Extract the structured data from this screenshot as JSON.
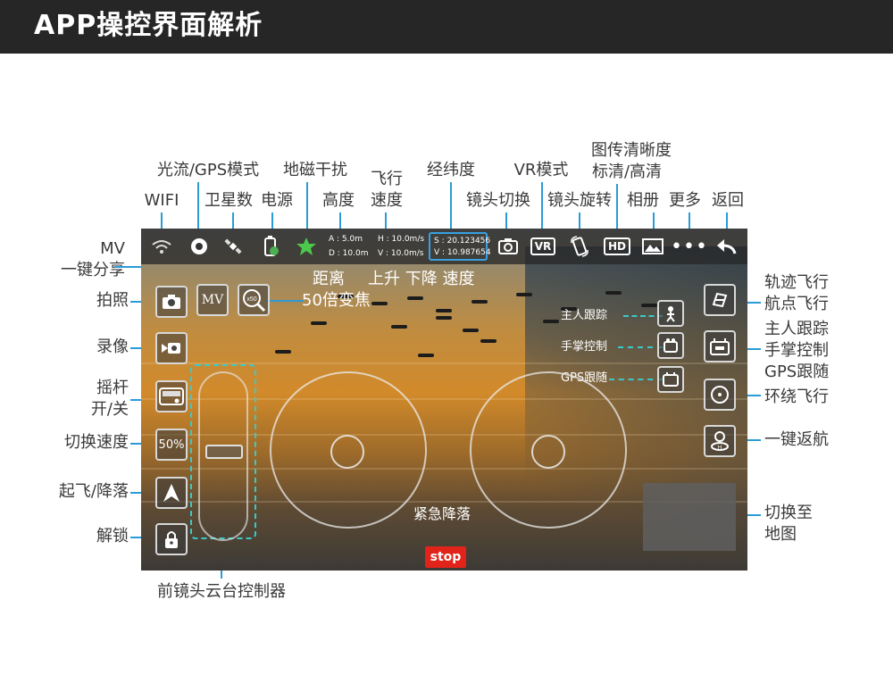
{
  "header": {
    "title": "APP操控界面解析"
  },
  "top_labels": {
    "wifi": "WIFI",
    "optical_flow_gps": "光流/GPS模式",
    "satellites": "卫星数",
    "power": "电源",
    "geomag": "地磁干扰",
    "altitude": "高度",
    "fly_speed_line1": "飞行",
    "fly_speed_line2": "速度",
    "lat_lon": "经纬度",
    "lens_switch": "镜头切换",
    "vr_mode": "VR模式",
    "lens_rotate": "镜头旋转",
    "transmission_line1": "图传清晰度",
    "transmission_line2": "标清/高清",
    "album": "相册",
    "more": "更多",
    "back": "返回"
  },
  "left_labels": {
    "mv_line1": "MV",
    "mv_line2": "一键分享",
    "photo": "拍照",
    "video": "录像",
    "joystick_line1": "摇杆",
    "joystick_line2": "开/关",
    "speed_switch": "切换速度",
    "takeoff_land": "起飞/降落",
    "unlock": "解锁"
  },
  "right_labels": {
    "trajectory_line1": "轨迹飞行",
    "trajectory_line2": "航点飞行",
    "follow_line1": "主人跟踪",
    "follow_line2": "手掌控制",
    "follow_line3": "GPS跟随",
    "orbit": "环绕飞行",
    "return_home": "一键返航",
    "map_switch_line1": "切换至",
    "map_switch_line2": "地图"
  },
  "bottom_labels": {
    "gimbal": "前镜头云台控制器"
  },
  "screen": {
    "telemetry": {
      "altitude": "A : 5.0m",
      "distance": "D : 10.0m",
      "h_speed": "H : 10.0m/s",
      "v_speed": "V : 10.0m/s",
      "lat": "S : 20.123456",
      "lon": "V : 10.987654"
    },
    "overlay": {
      "distance": "距离",
      "up_down_speed": "上升 下降 速度",
      "zoom": "50倍变焦",
      "owner_follow": "主人跟踪",
      "palm_control": "手掌控制",
      "gps_follow": "GPS跟随",
      "emergency_land": "紧急降落"
    },
    "buttons": {
      "mv": "MV",
      "zoom": "x50",
      "speed": "50%",
      "hd": "HD",
      "vr": "VR",
      "stop": "stop"
    },
    "icons": {
      "wifi": "wifi-icon",
      "gps": "gps-mode-icon",
      "satellite": "satellite-icon",
      "battery": "battery-icon",
      "compass": "geomagnetic-icon",
      "lens_switch": "camera-switch-icon",
      "rotate": "phone-rotate-icon",
      "album": "image-icon",
      "more": "more-icon",
      "back": "back-arrow-icon"
    }
  },
  "colors": {
    "accent_line": "#2b9bd6",
    "dash_line": "#3ac9c9",
    "stop": "#e2231a",
    "header_bg": "#262626"
  }
}
